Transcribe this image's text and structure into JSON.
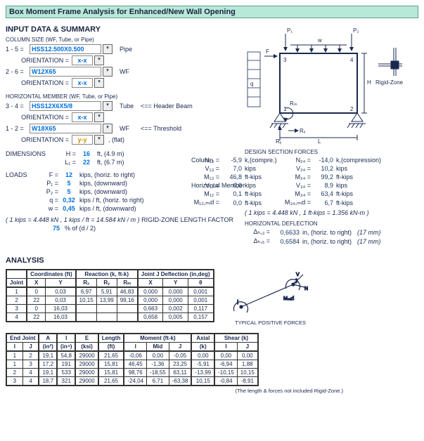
{
  "title": "Box Moment Frame Analysis for Enhanced/New Wall Opening",
  "input": {
    "heading": "INPUT DATA & SUMMARY",
    "col_size_lbl": "COLUMN SIZE (WF, Tube, or Pipe)",
    "c15_lbl": "1 - 5 =",
    "c15_val": "HSS12.500X0.500",
    "c15_type": "Pipe",
    "orient_lbl": "ORIENTATION =",
    "c15_orient": "x-x",
    "c26_lbl": "2 - 6 =",
    "c26_val": "W12X65",
    "c26_type": "WF",
    "c26_orient": "x-x",
    "hmem_lbl": "HORIZONTAL MEMBER (WF, Tube, or Pipe)",
    "h34_lbl": "3 - 4 =",
    "h34_val": "HSS12X6X5/8",
    "h34_type": "Tube",
    "h34_note": "<== Header Beam",
    "h34_orient": "x-x",
    "h12_lbl": "1 - 2 =",
    "h12_val": "W18X65",
    "h12_type": "WF",
    "h12_note": "<== Threshold",
    "h12_orient": "y-y",
    "h12_flat": ", (flat)",
    "dim_lbl": "DIMENSIONS",
    "H_lbl": "H =",
    "H_val": "16",
    "H_unit": "ft, (4.9 m)",
    "L1_lbl": "L₁ =",
    "L1_val": "22",
    "L1_unit": "ft, (6.7 m)",
    "loads_lbl": "LOADS",
    "F_lbl": "F =",
    "F_val": "12",
    "F_unit": "kips, (horiz. to right)",
    "P1_lbl": "P₁ =",
    "P1_val": "5",
    "P1_unit": "kips, (downward)",
    "P2_lbl": "P₂ =",
    "P2_val": "5",
    "P2_unit": "kips, (downward)",
    "q_lbl": "q =",
    "q_val": "0,32",
    "q_unit": "kips / ft, (horiz. to right)",
    "w_lbl": "w =",
    "w_val": "0,45",
    "w_unit": "kips / ft, (downward)",
    "conv": "( 1 kips = 4.448 kN ,   1 kips / ft = 14.584 kN / m )",
    "rz_lbl": "RIGID-ZONE LENGTH FACTOR",
    "rz_val": "75",
    "rz_unit": "% of (d / 2)"
  },
  "diagram": {
    "P1": "P₁",
    "P2": "P₂",
    "w": "w",
    "F": "F",
    "q": "q",
    "H": "H",
    "L": "L",
    "n1": "1",
    "n2": "2",
    "n3": "3",
    "n4": "4",
    "Rx": "Rₓ",
    "Ry": "Rᵧ",
    "Rm": "Rₘ",
    "rz": "Rigid-Zone"
  },
  "dsf": {
    "heading": "DESIGN SECTION FORCES",
    "col_lbl": "Column",
    "hmem_lbl": "Horizontal Member",
    "rows": [
      {
        "a": "N₁₃ =",
        "av": "-5,9",
        "au": "k,(compre.)",
        "b": "N₂₄ =",
        "bv": "-14,0",
        "bu": "k,(compression)"
      },
      {
        "a": "V₁₃ =",
        "av": "7,0",
        "au": "kips",
        "b": "V₂₄ =",
        "bv": "10,2",
        "bu": "kips"
      },
      {
        "a": "M₁₃ =",
        "av": "46,8",
        "au": "ft-kips",
        "b": "M₂₄ =",
        "bv": "99,2",
        "bu": "ft-kips"
      },
      {
        "a": "V₁₂ =",
        "av": "0,0",
        "au": "kips",
        "b": "V₃₄ =",
        "bv": "8,9",
        "bu": "kips"
      },
      {
        "a": "M₁₂ =",
        "av": "0,1",
        "au": "ft-kips",
        "b": "M₃₄ =",
        "bv": "63,4",
        "bu": "ft-kips"
      },
      {
        "a": "M₁₂,ₘᵢd =",
        "av": "0,0",
        "au": "ft-kips",
        "b": "M₃₄,ₘᵢd =",
        "bv": "6,7",
        "bu": "ft-kips"
      }
    ],
    "conv": "( 1 kips = 4.448 kN ,   1 ft-kips = 1.356 kN-m )"
  },
  "hd": {
    "heading": "HORIZONTAL DEFLECTION",
    "r1": {
      "a": "Δₕ,₃ =",
      "v": "0,6633",
      "u": "in, (horiz. to right)",
      "m": "(17 mm)"
    },
    "r2": {
      "a": "Δₕ,₅ =",
      "v": "0,6584",
      "u": "in, (horiz. to right)",
      "m": "(17 mm)"
    }
  },
  "analysis": {
    "heading": "ANALYSIS",
    "t1": {
      "g1": "Coordinates (ft)",
      "g2": "Reaction (k, ft-k)",
      "g3": "Joint J Deflection (in,deg)",
      "h": [
        "Joint",
        "X",
        "Y",
        "Rₓ",
        "Rᵧ",
        "Rₘ",
        "X",
        "Y",
        "θ"
      ],
      "rows": [
        [
          "1",
          "0",
          "0,03",
          "6,97",
          "5,91",
          "46,83",
          "0,000",
          "0,000",
          "0,001"
        ],
        [
          "2",
          "22",
          "0,03",
          "10,15",
          "13,99",
          "99,16",
          "0,000",
          "0,000",
          "0,001"
        ],
        [
          "3",
          "0",
          "16,03",
          "",
          "",
          "",
          "0,663",
          "0,002",
          "0,117"
        ],
        [
          "4",
          "22",
          "16,03",
          "",
          "",
          "",
          "0,658",
          "0,005",
          "0,157"
        ]
      ]
    },
    "fig_cap": "TYPICAL   POSITIVE   FORCES",
    "t2": {
      "g1": "End Joint",
      "g2": "A",
      "g3": "I",
      "g4": "E",
      "g5": "Length",
      "g6": "Moment (ft-k)",
      "g7": "Axial",
      "g8": "Shear (k)",
      "h": [
        "I",
        "J",
        "(in²)",
        "(in⁴)",
        "(ksi)",
        "(ft)",
        "I",
        "Mid",
        "J",
        "(k)",
        "I",
        "J"
      ],
      "rows": [
        [
          "1",
          "2",
          "19,1",
          "54,8",
          "29000",
          "21,65",
          "-0,06",
          "0,00",
          "-0,05",
          "0,00",
          "0,00",
          "0,00"
        ],
        [
          "1",
          "3",
          "17,2",
          "191",
          "29000",
          "15,81",
          "46,45",
          "-1,36",
          "23,25",
          "-5,91",
          "-6,94",
          "1,88"
        ],
        [
          "2",
          "4",
          "19,1",
          "533",
          "29000",
          "15,81",
          "98,76",
          "-18,55",
          "63,11",
          "-13,99",
          "-10,15",
          "10,15"
        ],
        [
          "3",
          "4",
          "18,7",
          "321",
          "29000",
          "21,65",
          "-24,04",
          "6,71",
          "-63,38",
          "10,15",
          "-0,84",
          "-8,91"
        ]
      ],
      "note": "(The length & forces not included Rigid-Zone.)"
    }
  }
}
